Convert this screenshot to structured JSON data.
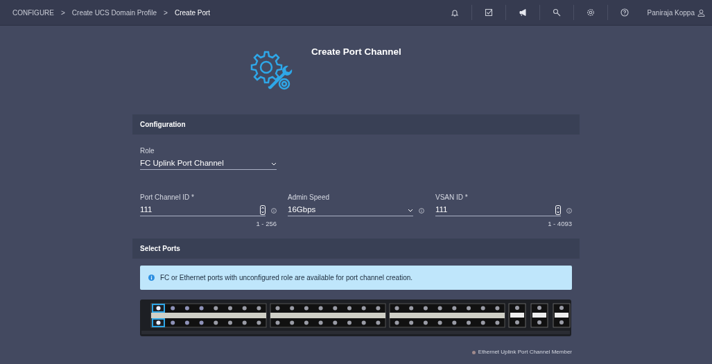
{
  "topbar": {
    "breadcrumbs": [
      {
        "label": "CONFIGURE",
        "current": false
      },
      {
        "label": "Create UCS Domain Profile",
        "current": false
      },
      {
        "label": "Create Port",
        "current": true
      }
    ],
    "separator": ">",
    "user": "Paniraja Koppa"
  },
  "page": {
    "title": "Create Port Channel"
  },
  "configuration": {
    "header": "Configuration",
    "role": {
      "label": "Role",
      "value": "FC Uplink Port Channel"
    },
    "fields": [
      {
        "kind": "number",
        "label": "Port Channel ID *",
        "value": "111",
        "hint": "1 - 256"
      },
      {
        "kind": "select",
        "label": "Admin Speed",
        "value": "16Gbps"
      },
      {
        "kind": "number",
        "label": "VSAN ID *",
        "value": "111",
        "hint": "1 - 4093"
      }
    ]
  },
  "select_ports": {
    "header": "Select Ports",
    "info": "FC or Ethernet ports with unconfigured role are available for port channel creation.",
    "selected_columns": [
      true,
      false,
      false,
      false,
      false,
      false,
      false,
      false,
      false,
      false,
      false,
      false,
      false,
      false,
      false,
      false,
      false,
      false,
      false,
      false,
      false,
      false,
      false,
      false
    ],
    "legend": [
      {
        "label": "Ethernet Uplink Port Channel Member",
        "color": "#a08a8c"
      }
    ]
  }
}
